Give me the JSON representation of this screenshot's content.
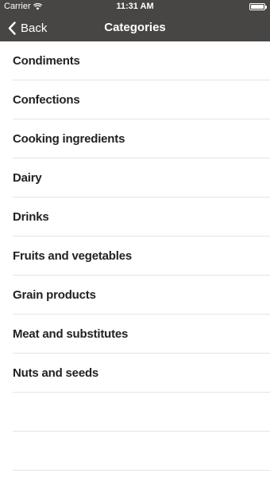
{
  "status_bar": {
    "carrier": "Carrier",
    "time": "11:31 AM",
    "icons": [
      "wifi-icon",
      "battery-icon"
    ]
  },
  "nav": {
    "back_label": "Back",
    "back_icon": "chevron-left-icon",
    "title": "Categories"
  },
  "categories": [
    "Condiments",
    "Confections",
    "Cooking ingredients",
    "Dairy",
    "Drinks",
    "Fruits and vegetables",
    "Grain products",
    "Meat and substitutes",
    "Nuts and seeds"
  ],
  "colors": {
    "bar_background": "#474645",
    "bar_text": "#ffffff",
    "list_text": "#222222",
    "separator": "#e4e4e4"
  }
}
